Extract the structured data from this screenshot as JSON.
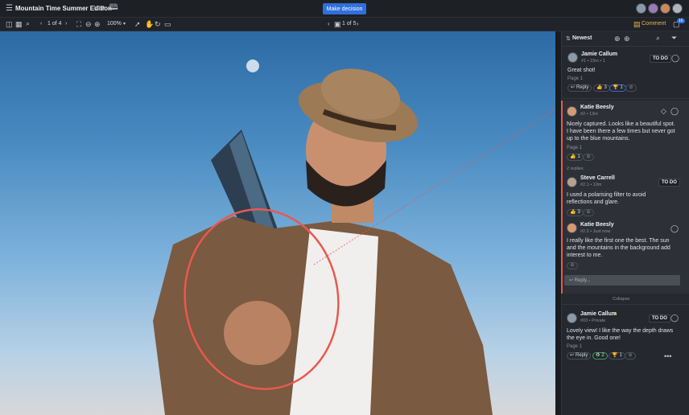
{
  "header": {
    "title": "Mountain Time Summer Edition",
    "version": "V.1",
    "decision_button": "Make decision"
  },
  "toolbar": {
    "page_indicator": "1 of 4",
    "zoom": "100%",
    "version_nav": "1 of 5",
    "comment_label": "Comment",
    "badge": "16"
  },
  "panel": {
    "sort_label": "Newest",
    "collapse_label": "Collapse",
    "reply_placeholder": "Reply..."
  },
  "comments": [
    {
      "author": "Jamie Callum",
      "meta": "#1 • 15m • 1",
      "text": "Great shot!",
      "page": "Page 1",
      "reply_label": "Reply",
      "likes": "3",
      "awards": "1",
      "status": "TO DO"
    },
    {
      "author": "Katie Beesly",
      "meta": "#2 • 13m",
      "text1": "Nicely captured. Looks like a beautiful spot.",
      "text2": "I have been there a few times but never got",
      "text3": "up to the blue mountains.",
      "page": "Page 1",
      "likes": "1",
      "replies_label": "2 replies"
    },
    {
      "author": "Steve Carrell",
      "meta": "#2.1 • 10m",
      "text1": "I used a polarising filter to avoid",
      "text2": "reflections and glare.",
      "likes": "3",
      "status": "TO DO"
    },
    {
      "author": "Katie Beesly",
      "meta": "#2.2 • Just now",
      "text1": "I really like the first one the best. The sun",
      "text2": "and the mountains in the background add",
      "text3": "interest to me."
    },
    {
      "author": "Jamie Callum",
      "meta": "#03 • Private",
      "text1": "Lovely view! I like the way the depth draws",
      "text2": "the eye in. Good one!",
      "page": "Page 1",
      "reply_label": "Reply",
      "likes": "2",
      "awards": "1",
      "status": "TO DO"
    }
  ],
  "colors": {
    "accent": "#2f6fde",
    "annotation": "#e8594f",
    "panel": "#25282e"
  }
}
